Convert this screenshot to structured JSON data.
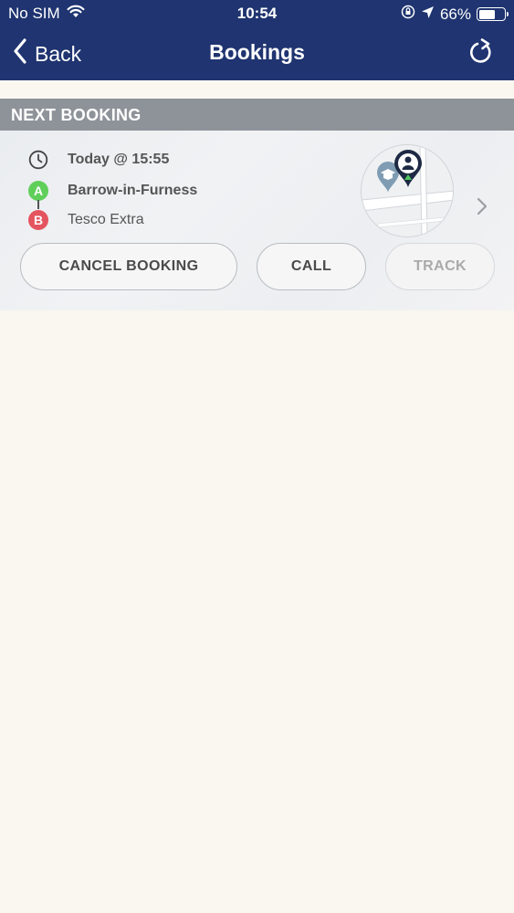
{
  "status_bar": {
    "carrier": "No SIM",
    "time": "10:54",
    "battery_percent": "66%",
    "battery_level": 0.66
  },
  "nav": {
    "back_label": "Back",
    "title": "Bookings"
  },
  "next_booking": {
    "section_title": "NEXT BOOKING",
    "time": "Today @ 15:55",
    "pickup_marker": "A",
    "pickup": "Barrow-in-Furness",
    "dropoff_marker": "B",
    "dropoff": "Tesco Extra"
  },
  "actions": {
    "cancel_label": "CANCEL BOOKING",
    "call_label": "CALL",
    "track_label": "TRACK"
  },
  "colors": {
    "header_bg": "#1f3470",
    "section_header_bg": "#8e9399",
    "marker_a": "#5fcf5a",
    "marker_b": "#e4545e",
    "page_bg": "#f9f7f0"
  },
  "icons": {
    "wifi": "wifi-icon",
    "location_lock": "orientation-lock-icon",
    "location_arrow": "location-arrow-icon",
    "battery": "battery-icon",
    "back": "chevron-left-icon",
    "refresh": "refresh-icon",
    "clock": "clock-icon",
    "map_person_pin": "person-pin-icon",
    "map_school_pin": "school-pin-icon",
    "chevron": "chevron-right-icon"
  }
}
